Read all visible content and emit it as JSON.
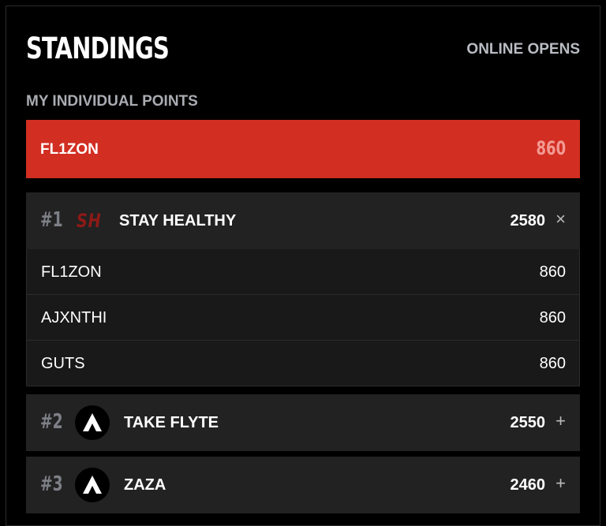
{
  "header": {
    "title": "STANDINGS",
    "event": "ONLINE OPENS"
  },
  "individual": {
    "heading": "MY INDIVIDUAL POINTS",
    "player": "FL1ZON",
    "points": "860"
  },
  "teams": [
    {
      "rank": "#1",
      "logo": "SH",
      "name": "STAY HEALTHY",
      "points": "2580",
      "toggle": "×",
      "expanded": true,
      "members": [
        {
          "name": "FL1ZON",
          "points": "860"
        },
        {
          "name": "AJXNTHI",
          "points": "860"
        },
        {
          "name": "GUTS",
          "points": "860"
        }
      ]
    },
    {
      "rank": "#2",
      "logo": "apex-logo-icon",
      "name": "TAKE FLYTE",
      "points": "2550",
      "toggle": "+"
    },
    {
      "rank": "#3",
      "logo": "apex-logo-icon",
      "name": "ZAZA",
      "points": "2460",
      "toggle": "+"
    }
  ],
  "colors": {
    "accent": "#d22e22",
    "row_bg": "#222222",
    "member_bg": "#191919"
  }
}
